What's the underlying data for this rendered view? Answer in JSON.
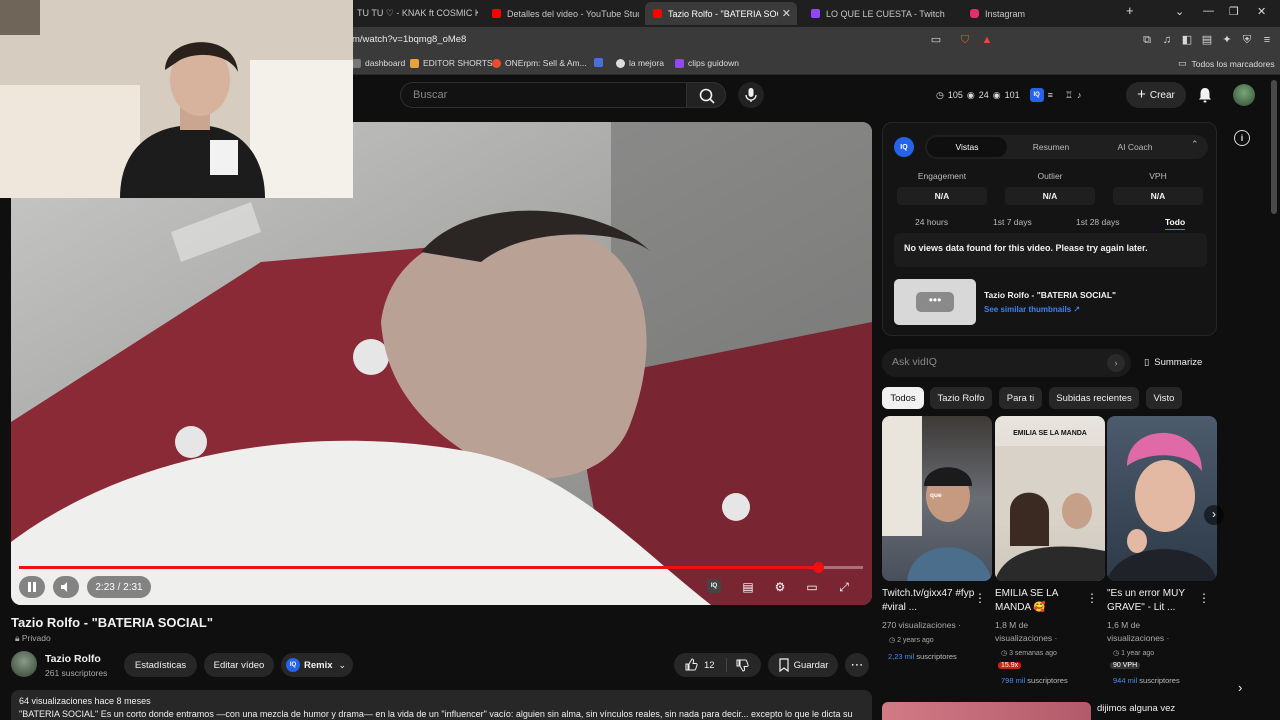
{
  "browser": {
    "tabs": [
      {
        "title": "TU TU ♡ - KNAK ft COSMIC KID",
        "favicon_color": "#ff0000"
      },
      {
        "title": "Detalles del video - YouTube Studio",
        "favicon_color": "#ff0000"
      },
      {
        "title": "Tazio Rolfo - \"BATERIA SOCIAL\"",
        "favicon_color": "#ff0000"
      },
      {
        "title": "LO QUE LE CUESTA - Twitch",
        "favicon_color": "#9146ff"
      },
      {
        "title": "Instagram",
        "favicon_color": "#e1306c"
      }
    ],
    "new_tab": "+",
    "url": "m/watch?v=1bqmg8_oMe8",
    "bookmarks": [
      {
        "label": "dashboard",
        "favicon_color": "#777777"
      },
      {
        "label": "EDITOR SHORTS",
        "favicon_color": "#e9a23b"
      },
      {
        "label": "ONErpm: Sell & Am...",
        "favicon_color": "#ee4b2b"
      },
      {
        "label": "",
        "favicon_color": "#4a6ee0"
      },
      {
        "label": "la mejora",
        "favicon_color": "#dddddd"
      },
      {
        "label": "clips guidown",
        "favicon_color": "#9146ff"
      }
    ],
    "all_bookmarks": "Todos los marcadores"
  },
  "youtube_header": {
    "search_placeholder": "Buscar",
    "stats": {
      "a": "105",
      "b": "24",
      "c": "101"
    },
    "create_label": "Crear"
  },
  "player": {
    "time": "2:23 / 2:31",
    "progress": 0.947
  },
  "video": {
    "title": "Tazio Rolfo - \"BATERIA SOCIAL\"",
    "privacy": "Privado",
    "channel_name": "Tazio Rolfo",
    "channel_subs": "261 suscriptores",
    "buttons": {
      "stats": "Estadísticas",
      "edit": "Editar vídeo",
      "remix": "Remix",
      "likes": "12",
      "save": "Guardar"
    },
    "views_line": "64 visualizaciones  hace 8 meses",
    "description": "\"BATERIA SOCIAL\" Es un corto donde entramos —con una mezcla de humor y drama— en la vida de un \"influencer\" vacío: alguien sin alma, sin vínculos reales, sin nada para decir... excepto lo que le dicta su"
  },
  "vidiq": {
    "badge": "IQ",
    "tabs": [
      "Vistas",
      "Resumen",
      "AI Coach"
    ],
    "metrics": [
      {
        "label": "Engagement",
        "value": "N/A"
      },
      {
        "label": "Outlier",
        "value": "N/A"
      },
      {
        "label": "VPH",
        "value": "N/A"
      }
    ],
    "ranges": [
      "24 hours",
      "1st 7 days",
      "1st 28 days",
      "Todo"
    ],
    "no_data": "No views data found for this video. Please try again later.",
    "thumb_title": "Tazio Rolfo - \"BATERIA SOCIAL\"",
    "similar": "See similar thumbnails ↗",
    "ask_placeholder": "Ask vidIQ",
    "summarize": "Summarize"
  },
  "chips": [
    "Todos",
    "Tazio Rolfo",
    "Para ti",
    "Subidas recientes",
    "Visto"
  ],
  "shorts": [
    {
      "title": "Twitch.tv/gixx47 #fyp #viral ...",
      "views": "270 visualizaciones ·",
      "age": "2 years ago",
      "subs_value": "2,23 mil",
      "subs_label": "suscriptores",
      "overlay": "que"
    },
    {
      "title": "EMILIA SE LA MANDA 🥰",
      "views": "1,8 M de visualizaciones ·",
      "age": "3 semanas ago",
      "tag": "15.9x",
      "subs_value": "798 mil",
      "subs_label": "suscriptores",
      "overlay": "EMILIA SE LA MANDA"
    },
    {
      "title": "\"Es un error MUY GRAVE\" - Lit ...",
      "views": "1,6 M de visualizaciones ·",
      "age": "1 year ago",
      "tag": "90 VPH",
      "subs_value": "944 mil",
      "subs_label": "suscriptores",
      "overlay": ""
    }
  ],
  "next_item_title": "dijimos alguna vez"
}
